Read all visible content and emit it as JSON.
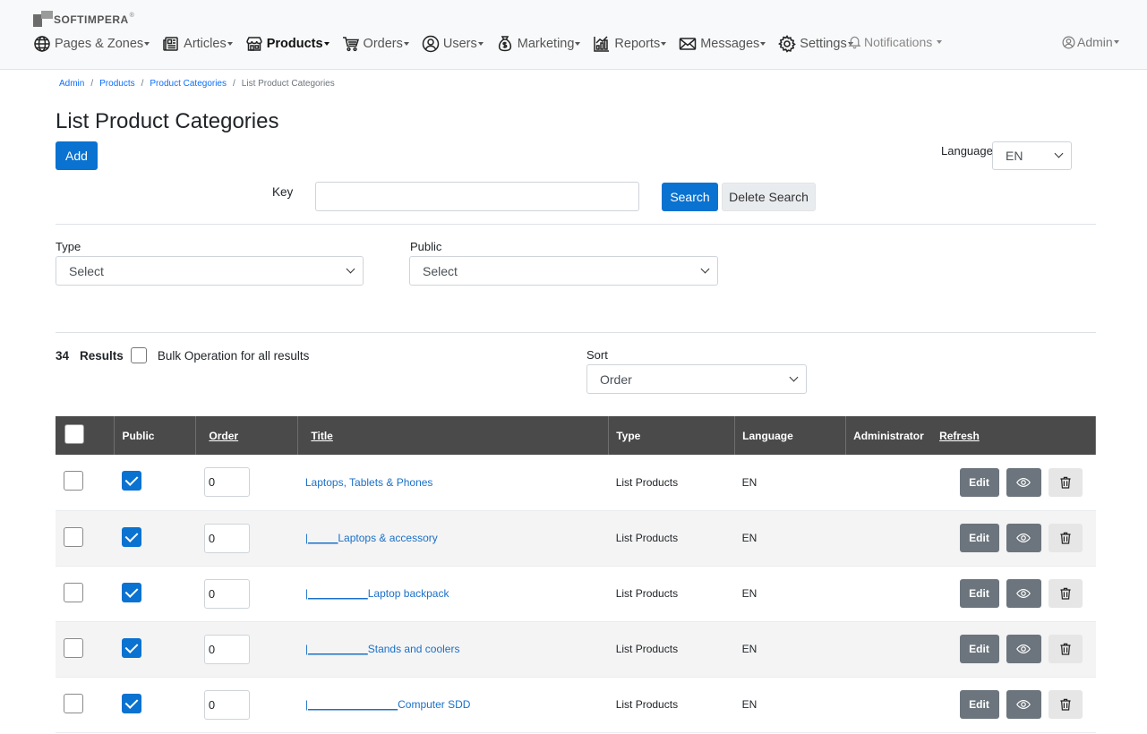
{
  "brand": {
    "name": "SOFTIMPERA",
    "reg": "®"
  },
  "nav": {
    "items": [
      {
        "label": "Pages & Zones",
        "icon": "globe-icon"
      },
      {
        "label": "Articles",
        "icon": "newspaper-icon"
      },
      {
        "label": "Products",
        "icon": "shop-icon"
      },
      {
        "label": "Orders",
        "icon": "cart-icon"
      },
      {
        "label": "Users",
        "icon": "user-circle-icon"
      },
      {
        "label": "Marketing",
        "icon": "money-bag-icon"
      },
      {
        "label": "Reports",
        "icon": "chart-icon"
      },
      {
        "label": "Messages",
        "icon": "envelope-icon"
      },
      {
        "label": "Settings",
        "icon": "gear-icon"
      }
    ],
    "notifications": "Notifications",
    "admin": "Admin"
  },
  "breadcrumb": [
    "Admin",
    "Products",
    "Product Categories",
    "List Product Categories"
  ],
  "page": {
    "title": "List Product Categories",
    "add_label": "Add",
    "language_label": "Language",
    "language_value": "EN"
  },
  "search": {
    "key_label": "Key",
    "key_value": "",
    "search_label": "Search",
    "delete_label": "Delete Search"
  },
  "filters": {
    "type_label": "Type",
    "type_value": "Select",
    "public_label": "Public",
    "public_value": "Select"
  },
  "results": {
    "count": "34",
    "label": "Results",
    "bulk_label": "Bulk Operation for all results",
    "sort_label": "Sort",
    "sort_value": "Order"
  },
  "table": {
    "headers": {
      "public": "Public",
      "order": "Order",
      "title": "Title",
      "type": "Type",
      "language": "Language",
      "administrator": "Administrator",
      "refresh": "Refresh"
    },
    "edit_label": "Edit",
    "rows": [
      {
        "public": true,
        "order": "0",
        "prefix": "",
        "title": "Laptops, Tablets & Phones",
        "type": "List Products",
        "language": "EN"
      },
      {
        "public": true,
        "order": "0",
        "prefix": "|_____",
        "title": "Laptops & accessory",
        "type": "List Products",
        "language": "EN"
      },
      {
        "public": true,
        "order": "0",
        "prefix": "|__________",
        "title": "Laptop backpack",
        "type": "List Products",
        "language": "EN"
      },
      {
        "public": true,
        "order": "0",
        "prefix": "|__________",
        "title": "Stands and coolers",
        "type": "List Products",
        "language": "EN"
      },
      {
        "public": true,
        "order": "0",
        "prefix": "|_______________",
        "title": "Computer SDD",
        "type": "List Products",
        "language": "EN"
      }
    ]
  },
  "colors": {
    "primary": "#0a72d0",
    "header_dark": "#4a4a4a",
    "secondary": "#6c757d"
  }
}
